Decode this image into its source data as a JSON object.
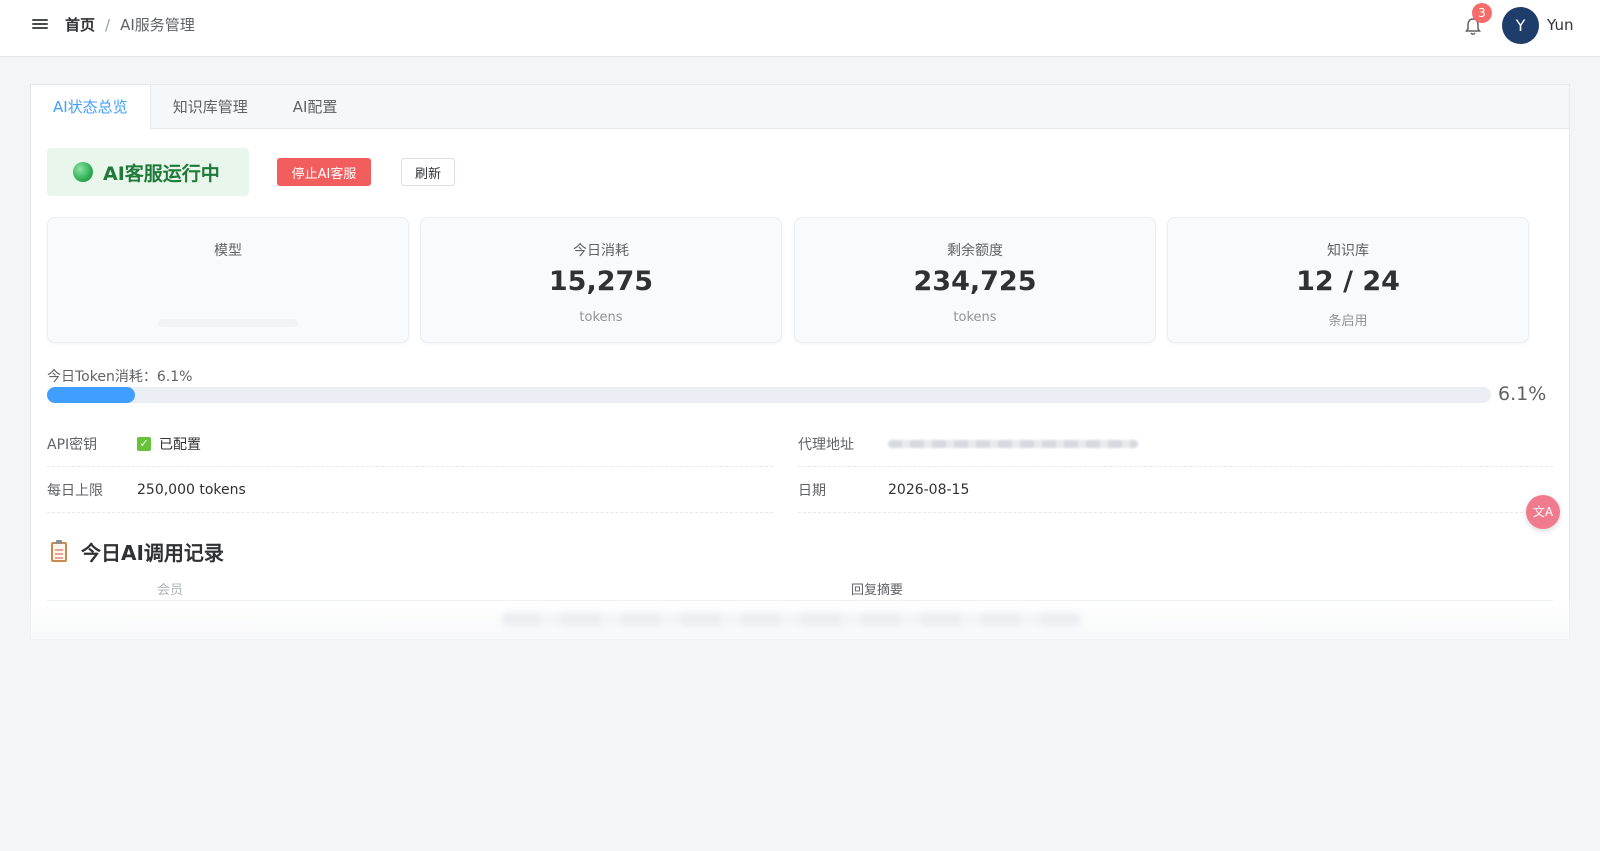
{
  "header": {
    "breadcrumb_home": "首页",
    "breadcrumb_sep": "/",
    "breadcrumb_current": "AI服务管理",
    "notification_count": "3",
    "avatar_letter": "Y",
    "username": "Yun"
  },
  "tabs": [
    {
      "label": "AI状态总览",
      "active": true
    },
    {
      "label": "知识库管理",
      "active": false
    },
    {
      "label": "AI配置",
      "active": false
    }
  ],
  "status": {
    "text": "AI客服运行中",
    "stop_button": "停止AI客服",
    "refresh_button": "刷新",
    "color": "#2fae52"
  },
  "stats": [
    {
      "label": "模型",
      "value": "",
      "unit": ""
    },
    {
      "label": "今日消耗",
      "value": "15,275",
      "unit": "tokens"
    },
    {
      "label": "剩余额度",
      "value": "234,725",
      "unit": "tokens"
    },
    {
      "label": "知识库",
      "value": "12 / 24",
      "unit": "条启用"
    }
  ],
  "usage": {
    "label": "今日Token消耗：6.1%",
    "percent_text": "6.1%",
    "percent": 6.1
  },
  "info": {
    "api_key_label": "API密钥",
    "api_key_value": "已配置",
    "proxy_label": "代理地址",
    "daily_limit_label": "每日上限",
    "daily_limit_value": "250,000 tokens",
    "date_label": "日期",
    "date_value": "2026-08-15"
  },
  "records": {
    "title": "今日AI调用记录",
    "columns": [
      "会员",
      "回复摘要"
    ]
  },
  "colors": {
    "accent": "#409eff",
    "danger": "#f25d5d",
    "success": "#67c23a"
  }
}
